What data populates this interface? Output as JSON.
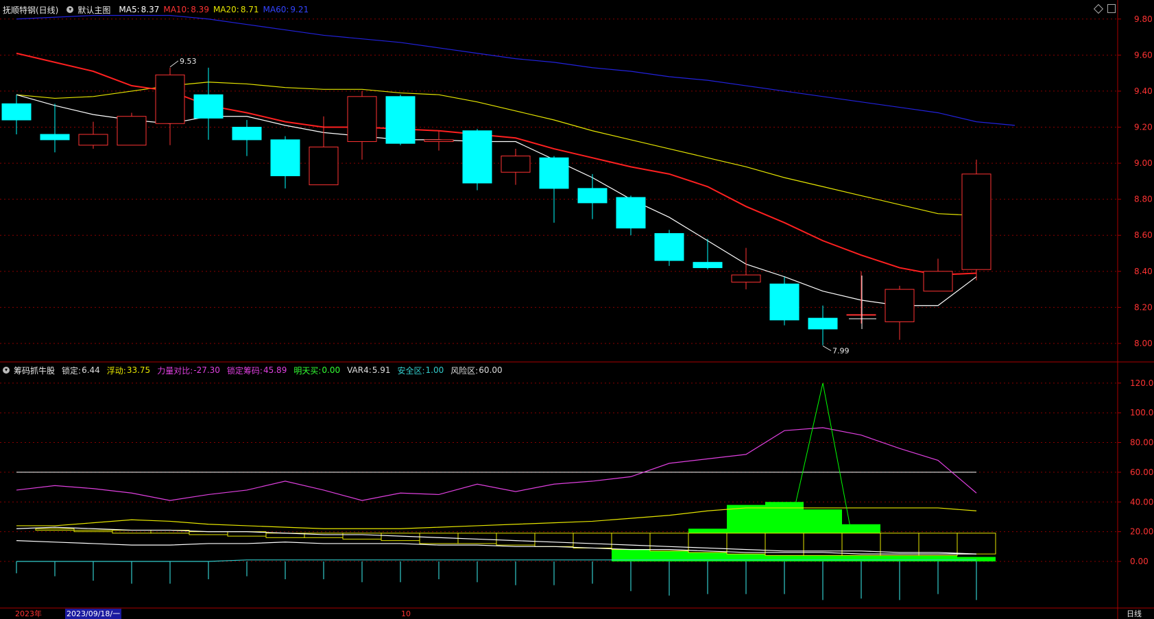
{
  "header_main": {
    "stock": "抚顺特钢(日线)",
    "chart_name": "默认主图",
    "ma5_label": "MA5:",
    "ma5_value": "8.37",
    "ma10_label": "MA10:",
    "ma10_value": "8.39",
    "ma20_label": "MA20:",
    "ma20_value": "8.71",
    "ma60_label": "MA60:",
    "ma60_value": "9.21"
  },
  "header_sub": {
    "indicator": "筹码抓牛股",
    "items": [
      {
        "label": "锁定:",
        "value": "6.44",
        "color": "#dddddd"
      },
      {
        "label": "浮动:",
        "value": "33.75",
        "color": "#e6e600"
      },
      {
        "label": "力量对比:",
        "value": "-27.30",
        "color": "#e040e0"
      },
      {
        "label": "锁定筹码:",
        "value": "45.89",
        "color": "#e040e0"
      },
      {
        "label": "明天买:",
        "value": "0.00",
        "color": "#33ff33"
      },
      {
        "label": "VAR4:",
        "value": "5.91",
        "color": "#dddddd"
      },
      {
        "label": "安全区:",
        "value": "1.00",
        "color": "#33cccc"
      },
      {
        "label": "风险区:",
        "value": "60.00",
        "color": "#dddddd"
      }
    ]
  },
  "bottom_axis": {
    "year_label": "2023年",
    "date_cursor": "2023/09/18/一",
    "month_label": "10",
    "period": "日线"
  },
  "icons": [
    "diamond-icon",
    "panel-icon",
    "circle-icon"
  ],
  "colors": {
    "up": "#ff3333",
    "down": "#00ffff",
    "ma5": "#ffffff",
    "ma10": "#ff2020",
    "ma20": "#e6e600",
    "ma60": "#2222dd",
    "grid": "#8b0000",
    "axis_text": "#ff3333",
    "pink": "#e040e0",
    "green": "#00ff00",
    "yellow": "#e6e600",
    "cyan": "#33cccc"
  },
  "chart_data": [
    {
      "type": "candlestick",
      "title": "抚顺特钢(日线)",
      "y_ticks": [
        8.0,
        8.2,
        8.4,
        8.6,
        8.8,
        9.0,
        9.2,
        9.4,
        9.6,
        9.8
      ],
      "ylim": [
        7.92,
        9.86
      ],
      "grid": true,
      "candles": [
        {
          "o": 9.33,
          "h": 9.38,
          "l": 9.16,
          "c": 9.24
        },
        {
          "o": 9.16,
          "h": 9.33,
          "l": 9.06,
          "c": 9.13
        },
        {
          "o": 9.1,
          "h": 9.23,
          "l": 9.08,
          "c": 9.16
        },
        {
          "o": 9.1,
          "h": 9.28,
          "l": 9.1,
          "c": 9.26
        },
        {
          "o": 9.22,
          "h": 9.53,
          "l": 9.1,
          "c": 9.49
        },
        {
          "o": 9.38,
          "h": 9.53,
          "l": 9.13,
          "c": 9.25
        },
        {
          "o": 9.2,
          "h": 9.24,
          "l": 9.04,
          "c": 9.13
        },
        {
          "o": 9.13,
          "h": 9.15,
          "l": 8.86,
          "c": 8.93
        },
        {
          "o": 8.88,
          "h": 9.26,
          "l": 8.88,
          "c": 9.09
        },
        {
          "o": 9.12,
          "h": 9.4,
          "l": 9.02,
          "c": 9.37
        },
        {
          "o": 9.37,
          "h": 9.38,
          "l": 9.1,
          "c": 9.11
        },
        {
          "o": 9.12,
          "h": 9.18,
          "l": 9.07,
          "c": 9.13
        },
        {
          "o": 9.18,
          "h": 9.19,
          "l": 8.85,
          "c": 8.89
        },
        {
          "o": 8.95,
          "h": 9.08,
          "l": 8.88,
          "c": 9.04
        },
        {
          "o": 9.03,
          "h": 9.04,
          "l": 8.67,
          "c": 8.86
        },
        {
          "o": 8.86,
          "h": 8.94,
          "l": 8.69,
          "c": 8.78
        },
        {
          "o": 8.81,
          "h": 8.82,
          "l": 8.6,
          "c": 8.64
        },
        {
          "o": 8.61,
          "h": 8.63,
          "l": 8.43,
          "c": 8.46
        },
        {
          "o": 8.45,
          "h": 8.58,
          "l": 8.41,
          "c": 8.42
        },
        {
          "o": 8.34,
          "h": 8.53,
          "l": 8.3,
          "c": 8.38
        },
        {
          "o": 8.33,
          "h": 8.37,
          "l": 8.1,
          "c": 8.13
        },
        {
          "o": 8.14,
          "h": 8.21,
          "l": 7.99,
          "c": 8.08
        },
        {
          "o": 8.16,
          "h": 8.4,
          "l": 8.11,
          "c": 8.16
        },
        {
          "o": 8.12,
          "h": 8.32,
          "l": 8.02,
          "c": 8.3
        },
        {
          "o": 8.29,
          "h": 8.47,
          "l": 8.29,
          "c": 8.4
        },
        {
          "o": 8.41,
          "h": 9.02,
          "l": 8.35,
          "c": 8.94
        }
      ],
      "ma5": [
        9.38,
        9.32,
        9.27,
        9.24,
        9.22,
        9.26,
        9.26,
        9.21,
        9.17,
        9.15,
        9.13,
        9.13,
        9.12,
        9.12,
        9.02,
        8.92,
        8.8,
        8.7,
        8.57,
        8.44,
        8.37,
        8.29,
        8.24,
        8.21,
        8.21,
        8.37
      ],
      "ma10": [
        9.61,
        9.56,
        9.51,
        9.43,
        9.4,
        9.32,
        9.28,
        9.23,
        9.2,
        9.2,
        9.19,
        9.18,
        9.16,
        9.14,
        9.08,
        9.03,
        8.98,
        8.94,
        8.87,
        8.76,
        8.67,
        8.57,
        8.49,
        8.42,
        8.38,
        8.39
      ],
      "ma20": [
        9.38,
        9.36,
        9.37,
        9.4,
        9.43,
        9.45,
        9.44,
        9.42,
        9.41,
        9.41,
        9.39,
        9.38,
        9.34,
        9.29,
        9.24,
        9.18,
        9.13,
        9.08,
        9.03,
        8.98,
        8.92,
        8.87,
        8.82,
        8.77,
        8.72,
        8.71
      ],
      "ma60": [
        9.8,
        9.81,
        9.82,
        9.82,
        9.82,
        9.8,
        9.77,
        9.74,
        9.71,
        9.69,
        9.67,
        9.64,
        9.61,
        9.58,
        9.56,
        9.53,
        9.51,
        9.48,
        9.46,
        9.43,
        9.4,
        9.37,
        9.34,
        9.31,
        9.28,
        9.23,
        9.21
      ],
      "annotations": [
        {
          "text": "9.53",
          "index": 4,
          "value": 9.53
        },
        {
          "text": "7.99",
          "index": 21,
          "value": 7.99
        }
      ]
    },
    {
      "type": "indicator",
      "title": "筹码抓牛股",
      "y_ticks": [
        0.0,
        20.0,
        40.0,
        60.0,
        80.0,
        100.0,
        120.0
      ],
      "ylim": [
        -30,
        125
      ],
      "risk_level": 60,
      "pink_line": [
        48,
        51,
        49,
        46,
        41,
        45,
        48,
        54,
        48,
        41,
        46,
        45,
        52,
        47,
        52,
        54,
        57,
        66,
        69,
        72,
        88,
        90,
        85,
        76,
        68,
        46
      ],
      "yellow_line": [
        24,
        24,
        26,
        28,
        27,
        25,
        24,
        23,
        22,
        22,
        22,
        23,
        24,
        25,
        26,
        27,
        29,
        31,
        34,
        36,
        36,
        36,
        36,
        36,
        36,
        34
      ],
      "white_line": [
        22,
        23,
        22,
        21,
        21,
        20,
        20,
        19,
        18,
        18,
        17,
        16,
        15,
        14,
        13,
        12,
        11,
        10,
        9,
        8,
        7,
        7,
        7,
        6,
        6,
        5
      ],
      "white_line2": [
        14,
        13,
        12,
        11,
        11,
        12,
        12,
        13,
        12,
        12,
        12,
        11,
        11,
        10,
        10,
        9,
        8,
        8,
        7,
        6,
        6,
        6,
        5,
        5,
        5,
        5
      ],
      "cyan_line": [
        0,
        0,
        0,
        0,
        0,
        0,
        1,
        1,
        1,
        1,
        1,
        1,
        1,
        1,
        1,
        1,
        1,
        1,
        1,
        1,
        1,
        1,
        1,
        1,
        1,
        1
      ],
      "green_spike": [
        0,
        0,
        0,
        0,
        0,
        0,
        0,
        0,
        0,
        0,
        0,
        0,
        0,
        0,
        0,
        0,
        0,
        0,
        0,
        0,
        0,
        120,
        0,
        0,
        0,
        0
      ],
      "green_bars": [
        0,
        0,
        0,
        0,
        0,
        0,
        0,
        0,
        0,
        0,
        0,
        0,
        0,
        0,
        0,
        0,
        0,
        0,
        22,
        38,
        40,
        35,
        25,
        0,
        0,
        0
      ],
      "green_low_bars": [
        0,
        0,
        0,
        0,
        0,
        0,
        0,
        0,
        0,
        0,
        0,
        0,
        0,
        0,
        0,
        0,
        8,
        7,
        6,
        5,
        4,
        4,
        4,
        4,
        4,
        3
      ],
      "boxes": [
        {
          "top": 23,
          "bottom": 23
        },
        {
          "top": 22,
          "bottom": 21
        },
        {
          "top": 21,
          "bottom": 20
        },
        {
          "top": 21,
          "bottom": 19
        },
        {
          "top": 21,
          "bottom": 19
        },
        {
          "top": 20,
          "bottom": 18
        },
        {
          "top": 20,
          "bottom": 17
        },
        {
          "top": 19,
          "bottom": 16
        },
        {
          "top": 19,
          "bottom": 16
        },
        {
          "top": 19,
          "bottom": 15
        },
        {
          "top": 19,
          "bottom": 14
        },
        {
          "top": 19,
          "bottom": 12
        },
        {
          "top": 19,
          "bottom": 12
        },
        {
          "top": 19,
          "bottom": 11
        },
        {
          "top": 19,
          "bottom": 10
        },
        {
          "top": 19,
          "bottom": 9
        },
        {
          "top": 19,
          "bottom": 8
        },
        {
          "top": 19,
          "bottom": 7
        },
        {
          "top": 19,
          "bottom": 6
        },
        {
          "top": 19,
          "bottom": 5
        },
        {
          "top": 19,
          "bottom": 4
        },
        {
          "top": 19,
          "bottom": 4
        },
        {
          "top": 19,
          "bottom": 4
        },
        {
          "top": 19,
          "bottom": 4
        },
        {
          "top": 19,
          "bottom": 4
        },
        {
          "top": 19,
          "bottom": 5
        }
      ],
      "cyan_sticks": [
        -8,
        -10,
        -13,
        -15,
        -15,
        -12,
        -10,
        -12,
        -12,
        -14,
        -14,
        -12,
        -14,
        -16,
        -16,
        -15,
        -20,
        -23,
        -22,
        -22,
        -22,
        -26,
        -25,
        -26,
        -22,
        -26
      ]
    }
  ]
}
